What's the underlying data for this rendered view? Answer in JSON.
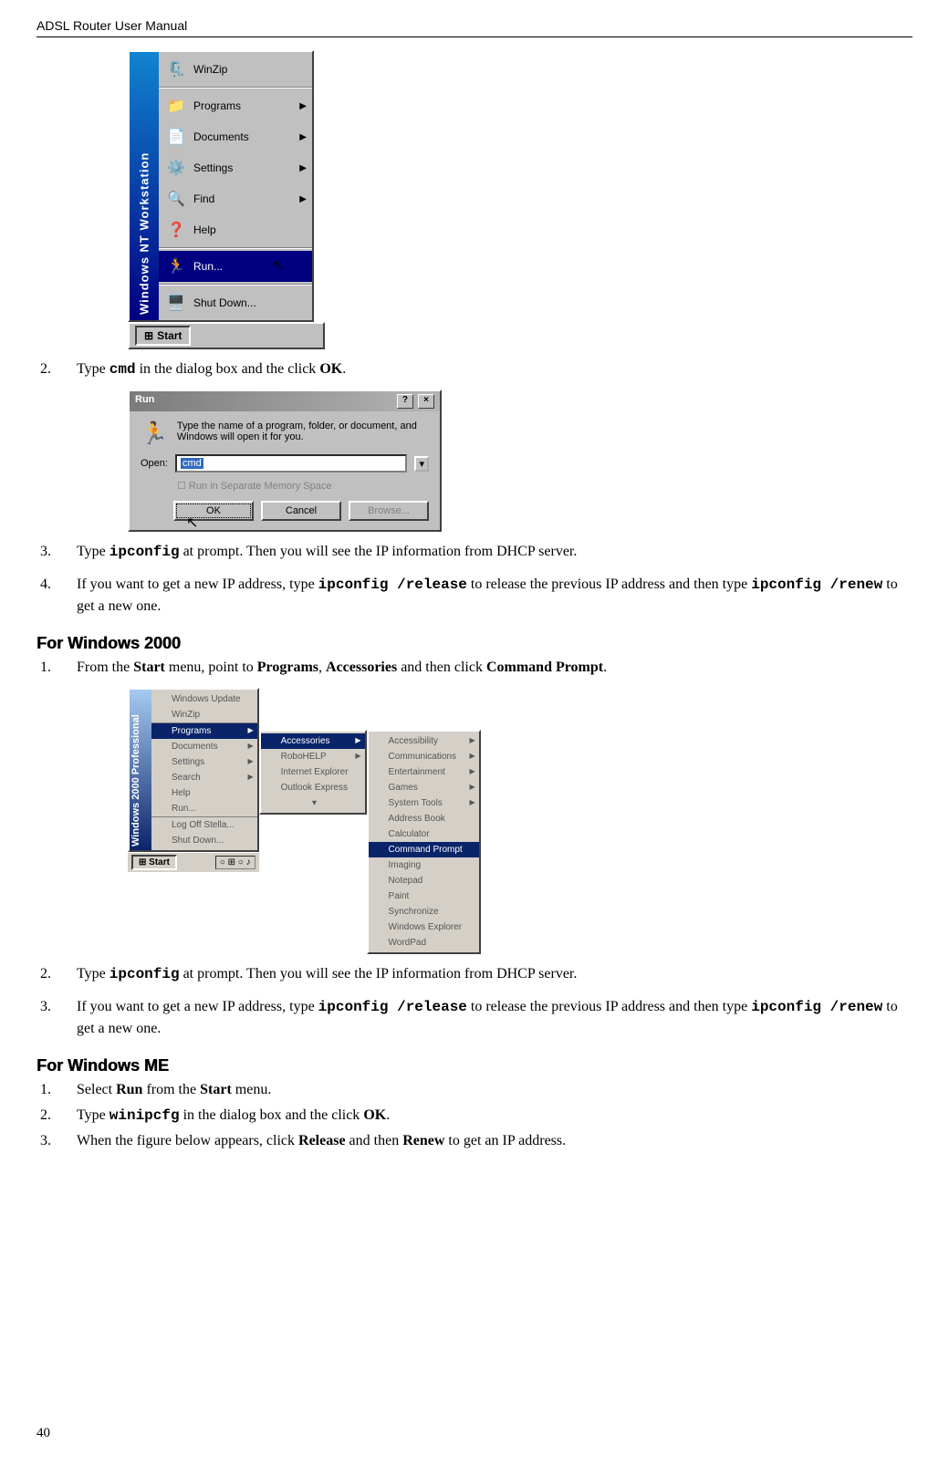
{
  "header": {
    "title": "ADSL Router User Manual"
  },
  "startmenu_nt": {
    "sidebar_label": "Windows NT Workstation",
    "items": [
      {
        "label": "WinZip",
        "icon": "🗜️",
        "arrow": false
      },
      {
        "label": "Programs",
        "icon": "📁",
        "arrow": true
      },
      {
        "label": "Documents",
        "icon": "📄",
        "arrow": true
      },
      {
        "label": "Settings",
        "icon": "⚙️",
        "arrow": true
      },
      {
        "label": "Find",
        "icon": "🔍",
        "arrow": true
      },
      {
        "label": "Help",
        "icon": "❓",
        "arrow": false
      },
      {
        "label": "Run...",
        "icon": "🏃",
        "arrow": false,
        "selected": true
      },
      {
        "label": "Shut Down...",
        "icon": "🖥️",
        "arrow": false
      }
    ],
    "start_button": "Start"
  },
  "step2_first": {
    "pre": "Type ",
    "cmd": "cmd",
    "mid": " in the dialog box and the click ",
    "ok": "OK",
    "post": "."
  },
  "run_dialog": {
    "title": "Run",
    "message": "Type the name of a program, folder, or document, and Windows will open it for you.",
    "open_label": "Open:",
    "open_value": "cmd",
    "separate_label": "Run in Separate Memory Space",
    "buttons": {
      "ok": "OK",
      "cancel": "Cancel",
      "browse": "Browse..."
    }
  },
  "step3_first": {
    "pre": "Type ",
    "cmd": "ipconfig",
    "post": " at prompt. Then you will see the IP information from DHCP server."
  },
  "step4_first": {
    "pre": "If you want to get a new IP address, type ",
    "cmd1": "ipconfig /release",
    "mid": " to release the previous IP address and then type ",
    "cmd2": "ipconfig /renew",
    "post": "  to get a new one."
  },
  "section_win2000": {
    "heading": "For Windows 2000",
    "step1": {
      "pre": "From the ",
      "b1": "Start",
      "m1": " menu, point to ",
      "b2": "Programs",
      "m2": ", ",
      "b3": "Accessories",
      "m3": " and then click ",
      "b4": "Command Prompt",
      "post": "."
    }
  },
  "w2k_menu": {
    "sidebar_label": "Windows 2000 Professional",
    "col1": [
      "Windows Update",
      "WinZip",
      "Programs",
      "Documents",
      "Settings",
      "Search",
      "Help",
      "Run...",
      "Log Off Stella...",
      "Shut Down..."
    ],
    "col1_selected": "Programs",
    "col2": [
      "Accessories",
      "RoboHELP",
      "Internet Explorer",
      "Outlook Express"
    ],
    "col2_selected": "Accessories",
    "col3": [
      "Accessibility",
      "Communications",
      "Entertainment",
      "Games",
      "System Tools",
      "Address Book",
      "Calculator",
      "Command Prompt",
      "Imaging",
      "Notepad",
      "Paint",
      "Synchronize",
      "Windows Explorer",
      "WordPad"
    ],
    "col3_selected": "Command Prompt",
    "taskbar": {
      "start": "Start",
      "tray": "○ ⊞ ○ ♪"
    }
  },
  "step2_2000": {
    "pre": "Type ",
    "cmd": "ipconfig",
    "post": " at prompt. Then you will see the IP information from DHCP server."
  },
  "step3_2000": {
    "pre": "If you want to get a new IP address, type ",
    "cmd1": "ipconfig /release",
    "mid": " to release the previous IP address and then type ",
    "cmd2": "ipconfig /renew",
    "post": "  to get a new one."
  },
  "section_winme": {
    "heading": "For Windows ME",
    "step1": {
      "pre": "Select ",
      "b1": "Run",
      "m1": " from the ",
      "b2": "Start",
      "post": " menu."
    },
    "step2": {
      "pre": "Type ",
      "cmd": "winipcfg",
      "mid": " in the dialog box and the click ",
      "ok": "OK",
      "post": "."
    },
    "step3": {
      "pre": "When the figure below appears, click ",
      "b1": "Release",
      "m1": " and then ",
      "b2": "Renew",
      "post": " to get an IP address."
    }
  },
  "footer": {
    "page": "40"
  }
}
